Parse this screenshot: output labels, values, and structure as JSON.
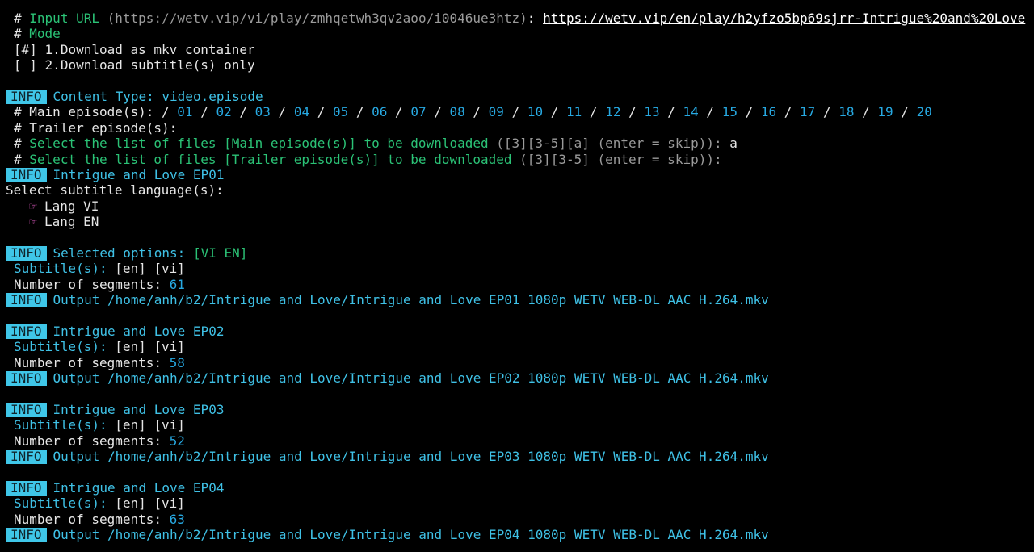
{
  "prompt": {
    "hash": "#",
    "url_label": "Input URL",
    "url_placeholder": "(https://wetv.vip/vi/play/zmhqetwh3qv2aoo/i0046ue3htz)",
    "colon": ":",
    "url_value": "https://wetv.vip/en/play/h2yfzo5bp69sjrr-Intrigue%20and%20Love",
    "mode_label": "Mode",
    "options": [
      {
        "marker": "[#]",
        "label": "1.Download as mkv container"
      },
      {
        "marker": "[ ]",
        "label": "2.Download subtitle(s) only"
      }
    ]
  },
  "info_tag": "INFO",
  "content_type_label": "Content Type:",
  "content_type_value": "video.episode",
  "main_episodes_label": "# Main episode(s):",
  "episode_numbers": [
    "01",
    "02",
    "03",
    "04",
    "05",
    "06",
    "07",
    "08",
    "09",
    "10",
    "11",
    "12",
    "13",
    "14",
    "15",
    "16",
    "17",
    "18",
    "19",
    "20"
  ],
  "trailer_label": "# Trailer episode(s):",
  "select_main": {
    "hash": "#",
    "text": "Select the list of files [Main episode(s)] to be downloaded",
    "hint": "([3][3-5][a] (enter = skip)):",
    "answer": "a"
  },
  "select_trailer": {
    "hash": "#",
    "text": "Select the list of files [Trailer episode(s)] to be downloaded",
    "hint": "([3][3-5] (enter = skip)):"
  },
  "first_title": "Intrigue and Love EP01",
  "subtitle_prompt": "Select subtitle language(s):",
  "languages": [
    "Lang VI",
    "Lang EN"
  ],
  "selected_label": "Selected options:",
  "selected_value": "[VI EN]",
  "subtitle_label": "Subtitle(s):",
  "segments_label": "Number of segments:",
  "episodes": [
    {
      "title": "",
      "subs": "[en] [vi]",
      "segments": "61",
      "output": "Output /home/anh/b2/Intrigue and Love/Intrigue and Love EP01 1080p WETV WEB-DL AAC H.264.mkv"
    },
    {
      "title": "Intrigue and Love EP02",
      "subs": "[en] [vi]",
      "segments": "58",
      "output": "Output /home/anh/b2/Intrigue and Love/Intrigue and Love EP02 1080p WETV WEB-DL AAC H.264.mkv"
    },
    {
      "title": "Intrigue and Love EP03",
      "subs": "[en] [vi]",
      "segments": "52",
      "output": "Output /home/anh/b2/Intrigue and Love/Intrigue and Love EP03 1080p WETV WEB-DL AAC H.264.mkv"
    },
    {
      "title": "Intrigue and Love EP04",
      "subs": "[en] [vi]",
      "segments": "63",
      "output": "Output /home/anh/b2/Intrigue and Love/Intrigue and Love EP04 1080p WETV WEB-DL AAC H.264.mkv"
    }
  ],
  "hand_icon_glyph": "☞",
  "colors": {
    "background": "#000000",
    "info_tag": "#3fc6e8",
    "cyan_text": "#3fc1e6",
    "green_text": "#2bc276",
    "number_blue": "#27a9e2",
    "hand_icon": "#e05bc2"
  }
}
